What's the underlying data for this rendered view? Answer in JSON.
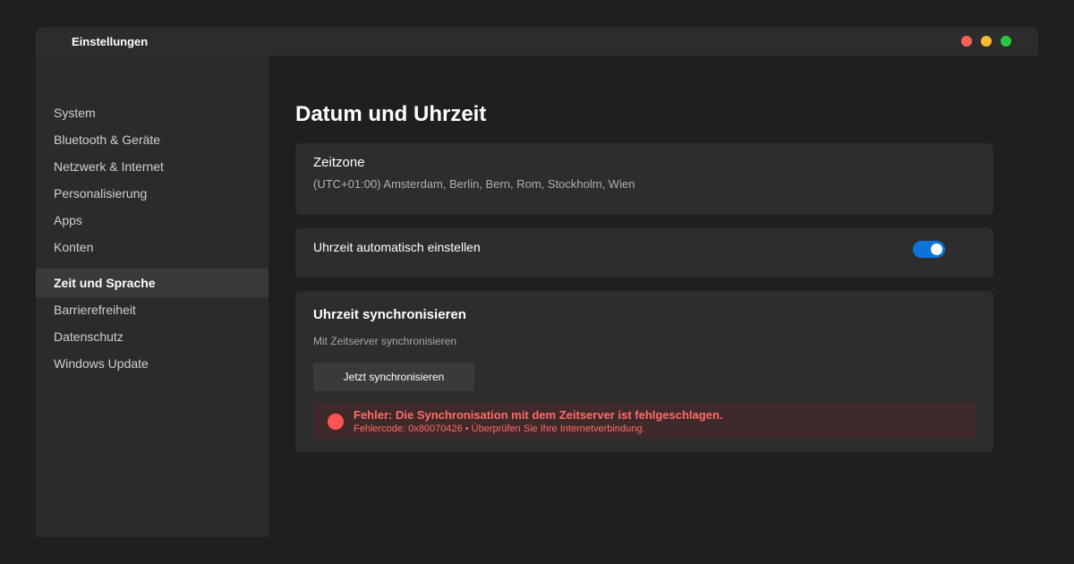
{
  "window": {
    "title": "Einstellungen",
    "controls": {
      "close_color": "#ff5f57",
      "minimize_color": "#febc2e",
      "maximize_color": "#28c840"
    }
  },
  "sidebar": {
    "items": [
      {
        "label": "System",
        "active": false
      },
      {
        "label": "Bluetooth & Geräte",
        "active": false
      },
      {
        "label": "Netzwerk & Internet",
        "active": false
      },
      {
        "label": "Personalisierung",
        "active": false
      },
      {
        "label": "Apps",
        "active": false
      },
      {
        "label": "Konten",
        "active": false
      },
      {
        "label": "Zeit und Sprache",
        "active": true
      },
      {
        "label": "Barrierefreiheit",
        "active": false
      },
      {
        "label": "Datenschutz",
        "active": false
      },
      {
        "label": "Windows Update",
        "active": false
      }
    ]
  },
  "main": {
    "page_title": "Datum und Uhrzeit",
    "timezone": {
      "label": "Zeitzone",
      "value": "(UTC+01:00) Amsterdam, Berlin, Bern, Rom, Stockholm, Wien"
    },
    "auto_time": {
      "label": "Uhrzeit automatisch einstellen",
      "enabled": true,
      "accent_color": "#0a74da"
    },
    "sync": {
      "title": "Uhrzeit synchronisieren",
      "subtitle": "Mit Zeitserver synchronisieren",
      "button_label": "Jetzt synchronisieren",
      "error": {
        "icon": "error-dot-icon",
        "color": "#ff5252",
        "title": "Fehler: Die Synchronisation mit dem Zeitserver ist fehlgeschlagen.",
        "detail": "Fehlercode: 0x80070426 • Überprüfen Sie Ihre Internetverbindung."
      }
    }
  }
}
